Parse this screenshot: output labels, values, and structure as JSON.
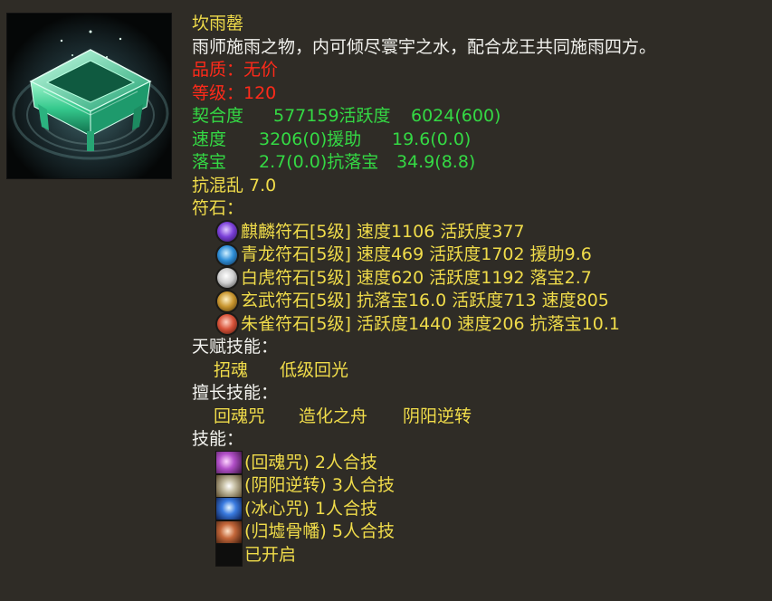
{
  "item": {
    "name": "坎雨罄",
    "description": "雨师施雨之物，内可倾尽寰宇之水，配合龙王共同施雨四方。",
    "quality": "品质：无价",
    "level": "等级：120"
  },
  "stats": {
    "row1": {
      "a_label": "契合度",
      "a_value": "577159活跃度",
      "b_value": "6024(600)"
    },
    "row2": {
      "a_label": "速度",
      "a_value": "3206(0)援助",
      "b_value": "19.6(0.0)"
    },
    "row3": {
      "a_label": "落宝",
      "a_value": "2.7(0.0)抗落宝",
      "b_value": "34.9(8.8)"
    },
    "extra": "抗混乱 7.0"
  },
  "runes": {
    "heading": "符石：",
    "items": [
      {
        "text": "麒麟符石[5级] 速度1106 活跃度377",
        "icon": "qilin-rune-icon",
        "color": "#7a3fd8"
      },
      {
        "text": "青龙符石[5级] 速度469 活跃度1702 援助9.6",
        "icon": "qinglong-rune-icon",
        "color": "#2f8fd8"
      },
      {
        "text": "白虎符石[5级] 速度620 活跃度1192 落宝2.7",
        "icon": "baihu-rune-icon",
        "color": "#d8d8d8"
      },
      {
        "text": "玄武符石[5级] 抗落宝16.0 活跃度713 速度805",
        "icon": "xuanwu-rune-icon",
        "color": "#c9962f"
      },
      {
        "text": "朱雀符石[5级] 活跃度1440 速度206 抗落宝10.1",
        "icon": "zhuque-rune-icon",
        "color": "#d8533a"
      }
    ]
  },
  "talent": {
    "heading": "天赋技能：",
    "items": [
      "招魂",
      "低级回光"
    ]
  },
  "specialty": {
    "heading": "擅长技能：",
    "items": [
      "回魂咒",
      "造化之舟",
      "阴阳逆转"
    ]
  },
  "skills": {
    "heading": "技能：",
    "items": [
      {
        "text": "(回魂咒) 2人合技",
        "icon": "huihunzhou-skill-icon"
      },
      {
        "text": "(阴阳逆转) 3人合技",
        "icon": "yinyang-skill-icon"
      },
      {
        "text": "(冰心咒) 1人合技",
        "icon": "bingxin-skill-icon"
      },
      {
        "text": "(归墟骨幡) 5人合技",
        "icon": "guixu-skill-icon"
      },
      {
        "text": "已开启",
        "icon": "locked-slot-icon"
      }
    ]
  }
}
